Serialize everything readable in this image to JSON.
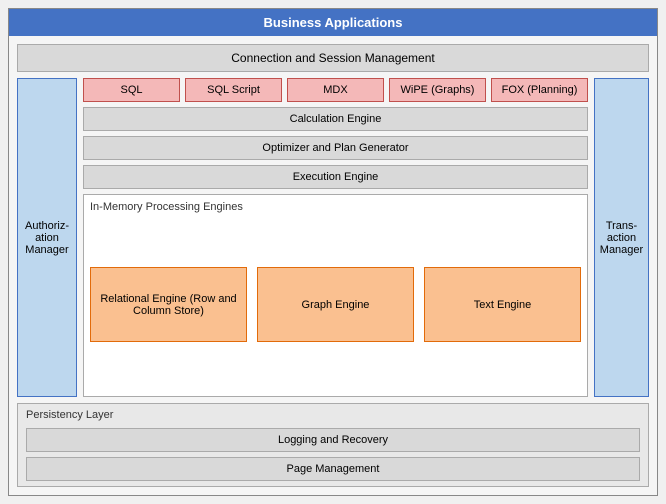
{
  "business_apps": {
    "label": "Business Applications"
  },
  "connection": {
    "label": "Connection and Session Management"
  },
  "auth_manager": {
    "label": "Authoriz-ation Manager"
  },
  "transaction_manager": {
    "label": "Trans-action Manager"
  },
  "query_types": [
    {
      "label": "SQL"
    },
    {
      "label": "SQL Script"
    },
    {
      "label": "MDX"
    },
    {
      "label": "WiPE (Graphs)"
    },
    {
      "label": "FOX (Planning)"
    }
  ],
  "engines": {
    "calculation": "Calculation Engine",
    "optimizer": "Optimizer and Plan Generator",
    "execution": "Execution Engine"
  },
  "in_memory": {
    "label": "In-Memory Processing Engines",
    "engines": [
      {
        "label": "Relational Engine (Row and Column Store)"
      },
      {
        "label": "Graph Engine"
      },
      {
        "label": "Text Engine"
      }
    ]
  },
  "persistency": {
    "label": "Persistency Layer",
    "bars": [
      {
        "label": "Logging and Recovery"
      },
      {
        "label": "Page Management"
      }
    ]
  }
}
